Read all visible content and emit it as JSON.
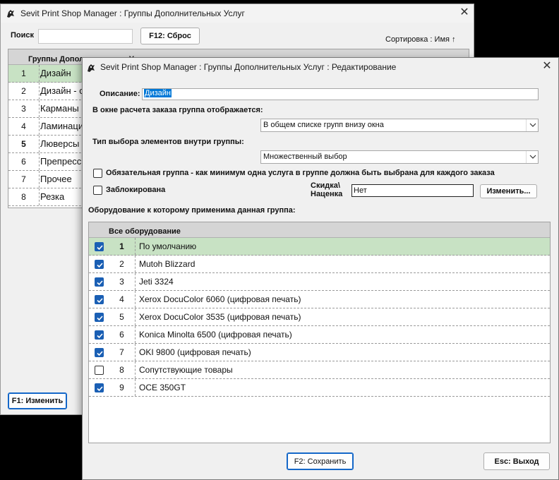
{
  "background_window": {
    "title": "Sevit Print Shop Manager : Группы Дополнительных Услуг",
    "search_label": "Поиск",
    "search_value": "",
    "reset_button": "F12: Сброс",
    "sort_label": "Сортировка : Имя ↑",
    "grid_header": "Группы Дополнительных Услуг",
    "rows": [
      {
        "num": "1",
        "name": "Дизайн"
      },
      {
        "num": "2",
        "name": "Дизайн - с"
      },
      {
        "num": "3",
        "name": "Карманы -"
      },
      {
        "num": "4",
        "name": "Ламинаци"
      },
      {
        "num": "5",
        "name": "Люверсы"
      },
      {
        "num": "6",
        "name": "Препресс"
      },
      {
        "num": "7",
        "name": "Прочее"
      },
      {
        "num": "8",
        "name": "Резка"
      }
    ],
    "edit_button": "F1: Изменить"
  },
  "dialog": {
    "title": "Sevit Print Shop Manager : Группы Дополнительных Услуг : Редактирование",
    "description_label": "Описание:",
    "description_value": "Дизайн",
    "display_label": "В окне расчета заказа группа отображается:",
    "display_value": "В общем списке групп внизу окна",
    "selection_type_label": "Тип выбора элементов внутри группы:",
    "selection_type_value": "Множественный выбор",
    "mandatory_label": "Обязательная группа - как минимум одна услуга в группе должна быть выбрана для каждого заказа",
    "mandatory_checked": false,
    "blocked_label": "Заблокирована",
    "blocked_checked": false,
    "discount_label_line1": "Скидка\\",
    "discount_label_line2": "Наценка",
    "discount_value": "Нет",
    "change_button": "Изменить...",
    "equipment_label": "Оборудование к которому применима данная группа:",
    "equipment_header": "Все оборудование",
    "equipment": [
      {
        "num": "1",
        "name": "По умолчанию",
        "checked": true
      },
      {
        "num": "2",
        "name": "Mutoh Blizzard",
        "checked": true
      },
      {
        "num": "3",
        "name": "Jeti 3324",
        "checked": true
      },
      {
        "num": "4",
        "name": "Xerox DocuColor 6060 (цифровая печать)",
        "checked": true
      },
      {
        "num": "5",
        "name": "Xerox DocuColor 3535 (цифровая печать)",
        "checked": true
      },
      {
        "num": "6",
        "name": "Konica Minolta 6500 (цифровая печать)",
        "checked": true
      },
      {
        "num": "7",
        "name": "OKI 9800 (цифровая печать)",
        "checked": true
      },
      {
        "num": "8",
        "name": "Сопутствующие товары",
        "checked": false
      },
      {
        "num": "9",
        "name": "OCE 350GT",
        "checked": true
      }
    ],
    "save_button": "F2: Сохранить",
    "exit_button": "Esc: Выход"
  },
  "icons": {
    "app": "app-icon",
    "close": "close-icon"
  },
  "colors": {
    "selected_row": "#c8e2c4",
    "checkbox": "#1a5fb4",
    "header": "#d5d5d5"
  }
}
